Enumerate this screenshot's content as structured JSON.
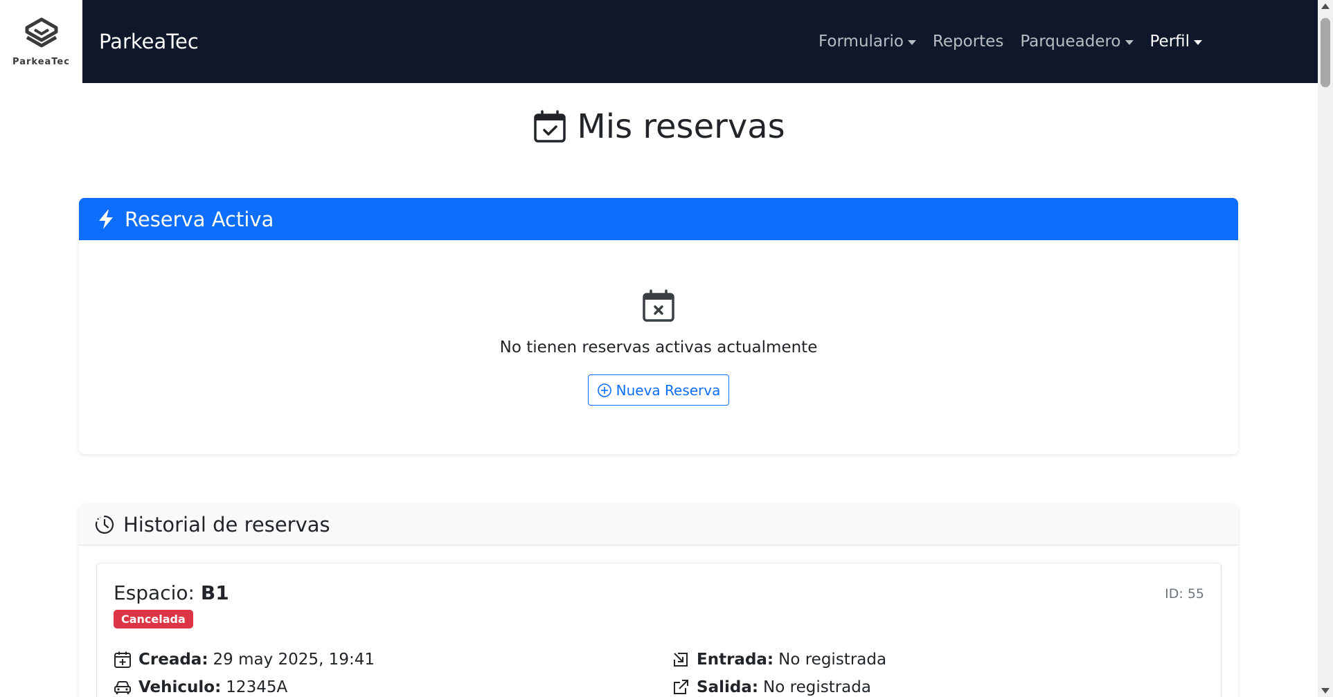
{
  "navbar": {
    "logo_text": "ParkeaTec",
    "brand": "ParkeaTec",
    "links": [
      {
        "label": "Formulario",
        "dropdown": true
      },
      {
        "label": "Reportes",
        "dropdown": false
      },
      {
        "label": "Parqueadero",
        "dropdown": true
      },
      {
        "label": "Perfil",
        "dropdown": true
      }
    ]
  },
  "page": {
    "title": "Mis reservas"
  },
  "active": {
    "header": "Reserva Activa",
    "empty_message": "No tienen reservas activas actualmente",
    "new_button": "Nueva Reserva"
  },
  "history": {
    "header": "Historial de reservas",
    "items": [
      {
        "space_label": "Espacio:",
        "space": "B1",
        "id": "ID: 55",
        "status": "Cancelada",
        "created_label": "Creada:",
        "created": "29 may 2025, 19:41",
        "vehicle_label": "Vehiculo:",
        "vehicle": "12345A",
        "entry_label": "Entrada:",
        "entry": "No registrada",
        "exit_label": "Salida:",
        "exit": "No registrada"
      }
    ]
  },
  "colors": {
    "navbar_bg": "#0f172a",
    "primary": "#0d6efd",
    "danger": "#dc3545"
  }
}
